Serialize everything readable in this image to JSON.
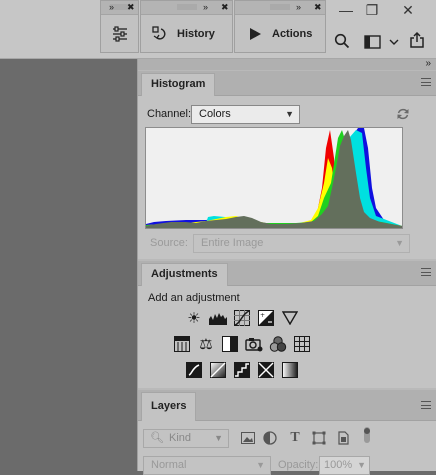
{
  "window": {
    "minimize_glyph": "—",
    "restore_glyph": "❐",
    "close_glyph": "✕"
  },
  "floating_panels": {
    "collapse_glyph": "»",
    "close_glyph": "✖",
    "history_label": "History",
    "actions_label": "Actions"
  },
  "dock": {
    "collapse_glyph": "»"
  },
  "histogram": {
    "tab_label": "Histogram",
    "channel_label": "Channel:",
    "channel_value": "Colors",
    "source_label": "Source:",
    "source_value": "Entire Image",
    "colors": {
      "red": "#f10000",
      "yellow": "#ffff00",
      "green": "#20d020",
      "cyan": "#00e0e0",
      "blue": "#1010e0",
      "gray": "#636f5c"
    }
  },
  "adjustments": {
    "tab_label": "Adjustments",
    "subtitle": "Add an adjustment"
  },
  "layers": {
    "tab_label": "Layers",
    "kind_placeholder": "Kind",
    "blend_mode": "Normal",
    "opacity_label": "Opacity:",
    "opacity_value": "100%"
  }
}
